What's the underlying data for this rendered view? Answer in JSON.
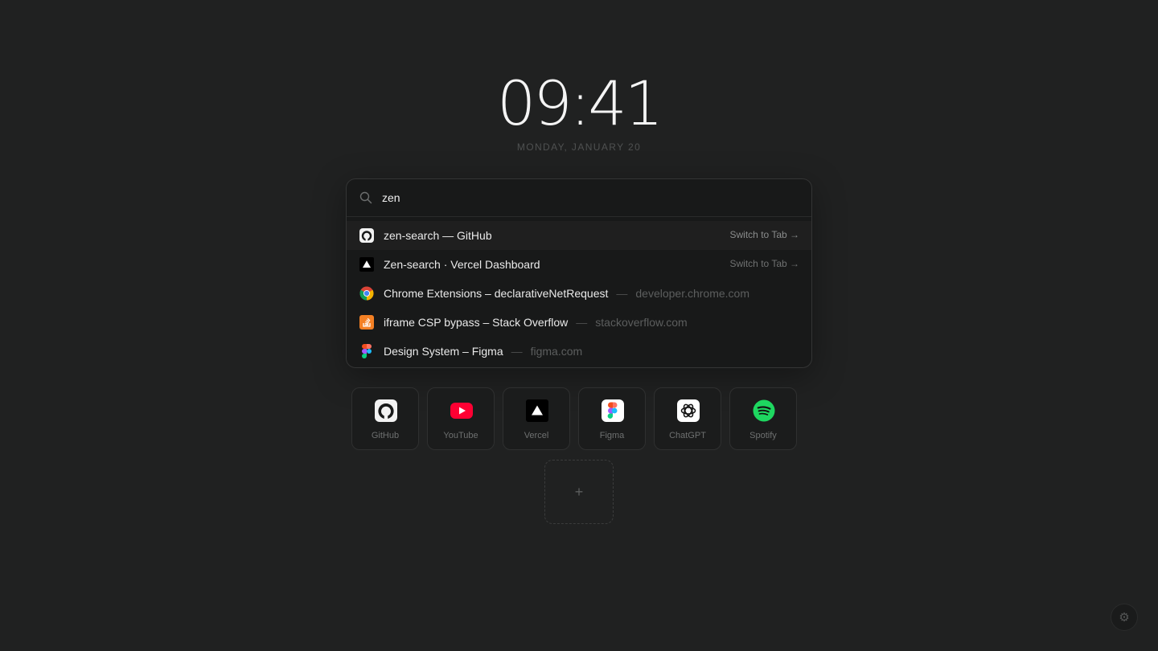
{
  "clock": {
    "time": "09:41",
    "date": "MONDAY, JANUARY 20"
  },
  "search": {
    "value": "zen"
  },
  "results": [
    {
      "title": "zen-search — GitHub",
      "action": "Switch to Tab →",
      "icon": "github-icon"
    },
    {
      "title": "Zen-search · Vercel Dashboard",
      "action": "Switch to Tab →",
      "icon": "vercel-icon"
    },
    {
      "title": "Chrome Extensions – declarativeNetRequest",
      "separator": "—",
      "domain": "developer.chrome.com",
      "icon": "chrome-icon"
    },
    {
      "title": "iframe CSP bypass – Stack Overflow",
      "separator": "—",
      "domain": "stackoverflow.com",
      "icon": "stackoverflow-icon"
    },
    {
      "title": "Design System – Figma",
      "separator": "—",
      "domain": "figma.com",
      "icon": "figma-icon"
    }
  ],
  "shortcuts": [
    {
      "label": "GitHub",
      "icon": "github-icon"
    },
    {
      "label": "YouTube",
      "icon": "youtube-icon"
    },
    {
      "label": "Vercel",
      "icon": "vercel-icon"
    },
    {
      "label": "Figma",
      "icon": "figma-icon"
    },
    {
      "label": "ChatGPT",
      "icon": "chatgpt-icon"
    },
    {
      "label": "Spotify",
      "icon": "spotify-icon"
    }
  ],
  "add_tile": {
    "symbol": "+"
  },
  "settings": {
    "icon": "gear-icon",
    "glyph": "⚙"
  },
  "colors": {
    "background": "#202121",
    "youtube": "#FF0033",
    "spotify": "#1ED760"
  }
}
